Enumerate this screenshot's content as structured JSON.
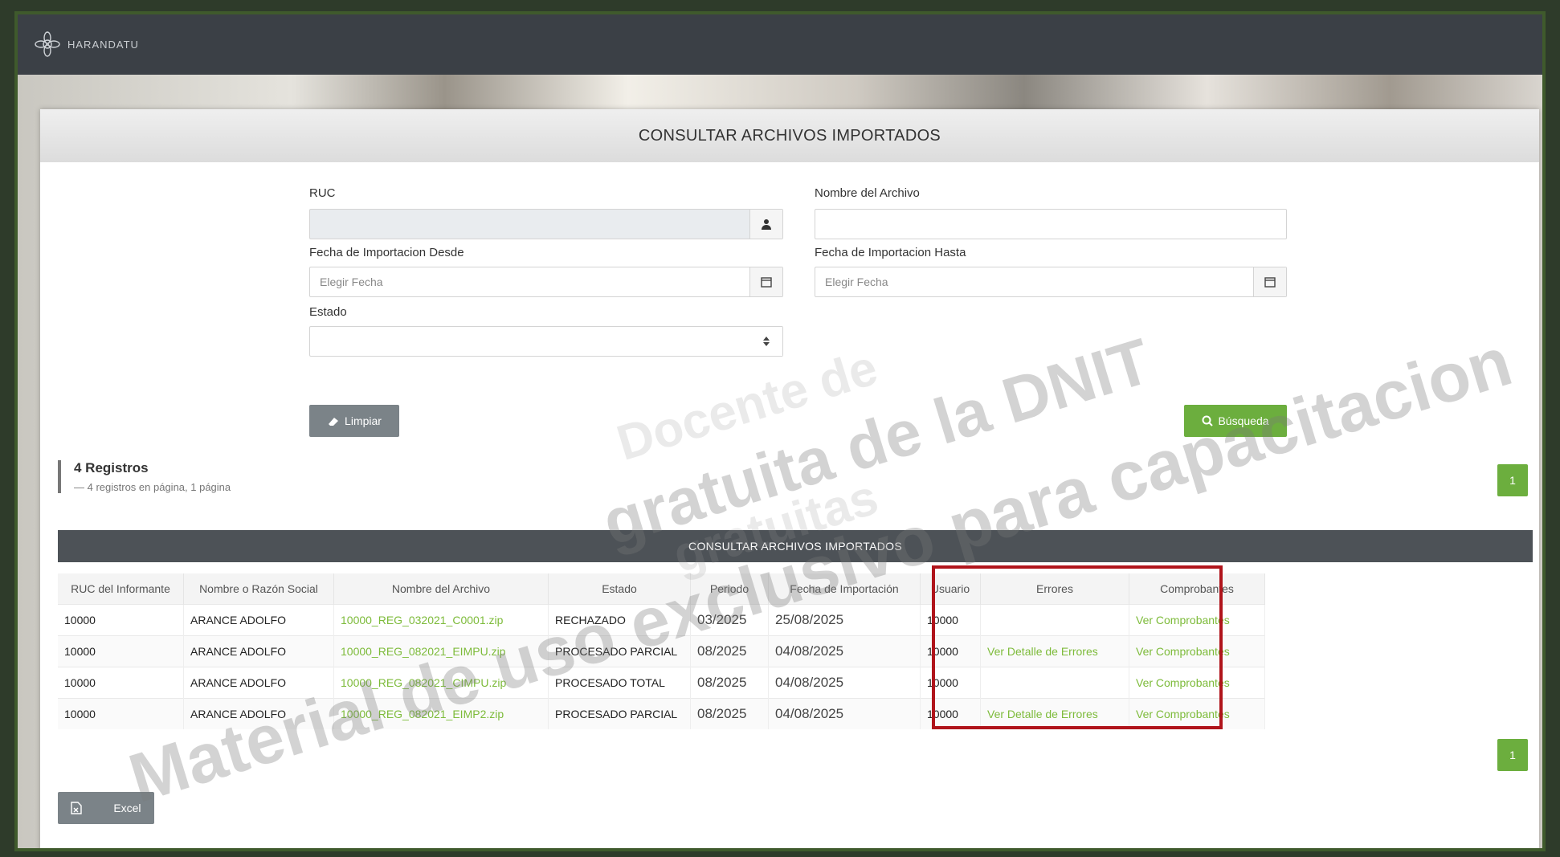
{
  "app": {
    "name": "HARANDATU"
  },
  "page": {
    "title": "CONSULTAR ARCHIVOS IMPORTADOS"
  },
  "form": {
    "ruc_label": "RUC",
    "nombre_label": "Nombre del Archivo",
    "desde_label": "Fecha de Importacion Desde",
    "hasta_label": "Fecha de Importacion Hasta",
    "estado_label": "Estado",
    "desde_placeholder": "Elegir Fecha",
    "hasta_placeholder": "Elegir Fecha",
    "limpiar_label": "Limpiar",
    "busqueda_label": "Búsqueda"
  },
  "registros": {
    "title": "4 Registros",
    "subtitle": "— 4 registros en página, 1 página"
  },
  "pagination": {
    "page": "1"
  },
  "table": {
    "title": "CONSULTAR ARCHIVOS IMPORTADOS",
    "headers": [
      "RUC del Informante",
      "Nombre o Razón Social",
      "Nombre del Archivo",
      "Estado",
      "Periodo",
      "Fecha de Importación",
      "Usuario",
      "Errores",
      "Comprobantes"
    ],
    "rows": [
      {
        "ruc": "10000",
        "nombre": "ARANCE ADOLFO",
        "archivo": "10000_REG_032021_C0001.zip",
        "estado": "RECHAZADO",
        "periodo": "03/2025",
        "fecha": "25/08/2025",
        "usuario": "10000",
        "errores": "",
        "comprobantes": "Ver Comprobantes"
      },
      {
        "ruc": "10000",
        "nombre": "ARANCE ADOLFO",
        "archivo": "10000_REG_082021_EIMPU.zip",
        "estado": "PROCESADO PARCIAL",
        "periodo": "08/2025",
        "fecha": "04/08/2025",
        "usuario": "10000",
        "errores": "Ver Detalle de Errores",
        "comprobantes": "Ver Comprobantes"
      },
      {
        "ruc": "10000",
        "nombre": "ARANCE ADOLFO",
        "archivo": "10000_REG_082021_CIMPU.zip",
        "estado": "PROCESADO TOTAL",
        "periodo": "08/2025",
        "fecha": "04/08/2025",
        "usuario": "10000",
        "errores": "",
        "comprobantes": "Ver Comprobantes"
      },
      {
        "ruc": "10000",
        "nombre": "ARANCE ADOLFO",
        "archivo": "10000_REG_082021_EIMP2.zip",
        "estado": "PROCESADO PARCIAL",
        "periodo": "08/2025",
        "fecha": "04/08/2025",
        "usuario": "10000",
        "errores": "Ver Detalle de Errores",
        "comprobantes": "Ver Comprobantes"
      }
    ]
  },
  "excel": {
    "label": "Excel"
  },
  "watermark": {
    "line1": "Material de uso exclusivo para capacitacion",
    "line2": "gratuita de la DNIT",
    "line3": "Docente de",
    "line4": "gratuitas"
  },
  "colors": {
    "accent_green": "#6cae3e",
    "link_green": "#7dbb3a",
    "highlight_red": "#b0141b",
    "topbar": "#3b4046"
  },
  "icons": {
    "ruc": "user-icon",
    "date": "calendar-icon",
    "estado": "select-arrows-icon",
    "limpiar": "eraser-icon",
    "busqueda": "search-icon",
    "excel": "excel-file-icon"
  }
}
